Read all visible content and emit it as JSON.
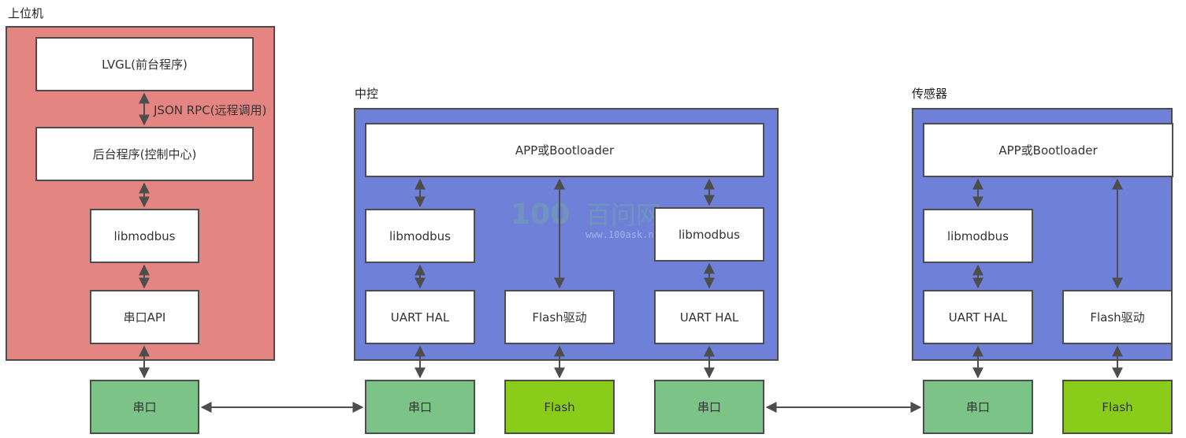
{
  "groups": {
    "host": {
      "title": "上位机",
      "color": "#e58582"
    },
    "controller": {
      "title": "中控",
      "color": "#6f80d9"
    },
    "sensor": {
      "title": "传感器",
      "color": "#6f80d9"
    }
  },
  "host": {
    "lvgl": "LVGL(前台程序)",
    "rpc_note": "JSON RPC(远程调用)",
    "backend": "后台程序(控制中心)",
    "libmodbus": "libmodbus",
    "serial_api": "串口API"
  },
  "controller": {
    "app": "APP或Bootloader",
    "libmodbus_left": "libmodbus",
    "libmodbus_right": "libmodbus",
    "uart_left": "UART HAL",
    "flash_driver": "Flash驱动",
    "uart_right": "UART HAL"
  },
  "sensor": {
    "app": "APP或Bootloader",
    "libmodbus": "libmodbus",
    "uart": "UART HAL",
    "flash_driver": "Flash驱动"
  },
  "hardware": {
    "host_serial": "串口",
    "ctrl_serial_left": "串口",
    "ctrl_flash": "Flash",
    "ctrl_serial_right": "串口",
    "sensor_serial": "串口",
    "sensor_flash": "Flash"
  },
  "colors": {
    "serial_green": "#7bc386",
    "flash_lime": "#8acc1a",
    "border": "#4d4d4d"
  },
  "watermark": {
    "brand": "百问网",
    "url": "www.100ask.net"
  }
}
